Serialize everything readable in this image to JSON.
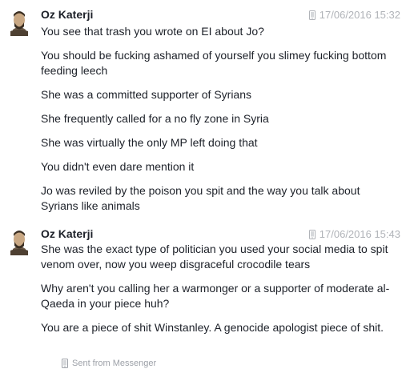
{
  "groups": [
    {
      "sender": "Oz Katerji",
      "timestamp": "17/06/2016 15:32",
      "messages": [
        "You see that trash you wrote on EI about Jo?",
        "You should be fucking ashamed of yourself you slimey fucking bottom feeding leech",
        "She was a committed supporter of Syrians",
        "She frequently called for a no fly zone in Syria",
        "She was virtually the only MP left doing that",
        "You didn't even dare mention it",
        "Jo was reviled by the poison you spit and the way you talk about Syrians like animals"
      ]
    },
    {
      "sender": "Oz Katerji",
      "timestamp": "17/06/2016 15:43",
      "messages": [
        "She was the exact type of politician you used your social media to spit venom over, now you weep disgraceful crocodile tears",
        "Why aren't you calling her a warmonger or a supporter of moderate al-Qaeda in your piece huh?",
        "You are a piece of shit Winstanley. A genocide apologist piece of shit."
      ]
    }
  ],
  "footer": {
    "label": "Sent from Messenger",
    "icon": "mobile-phone-icon"
  },
  "colors": {
    "text": "#1d2129",
    "timestamp": "#b0b3b8",
    "footer": "#9da1a8"
  }
}
